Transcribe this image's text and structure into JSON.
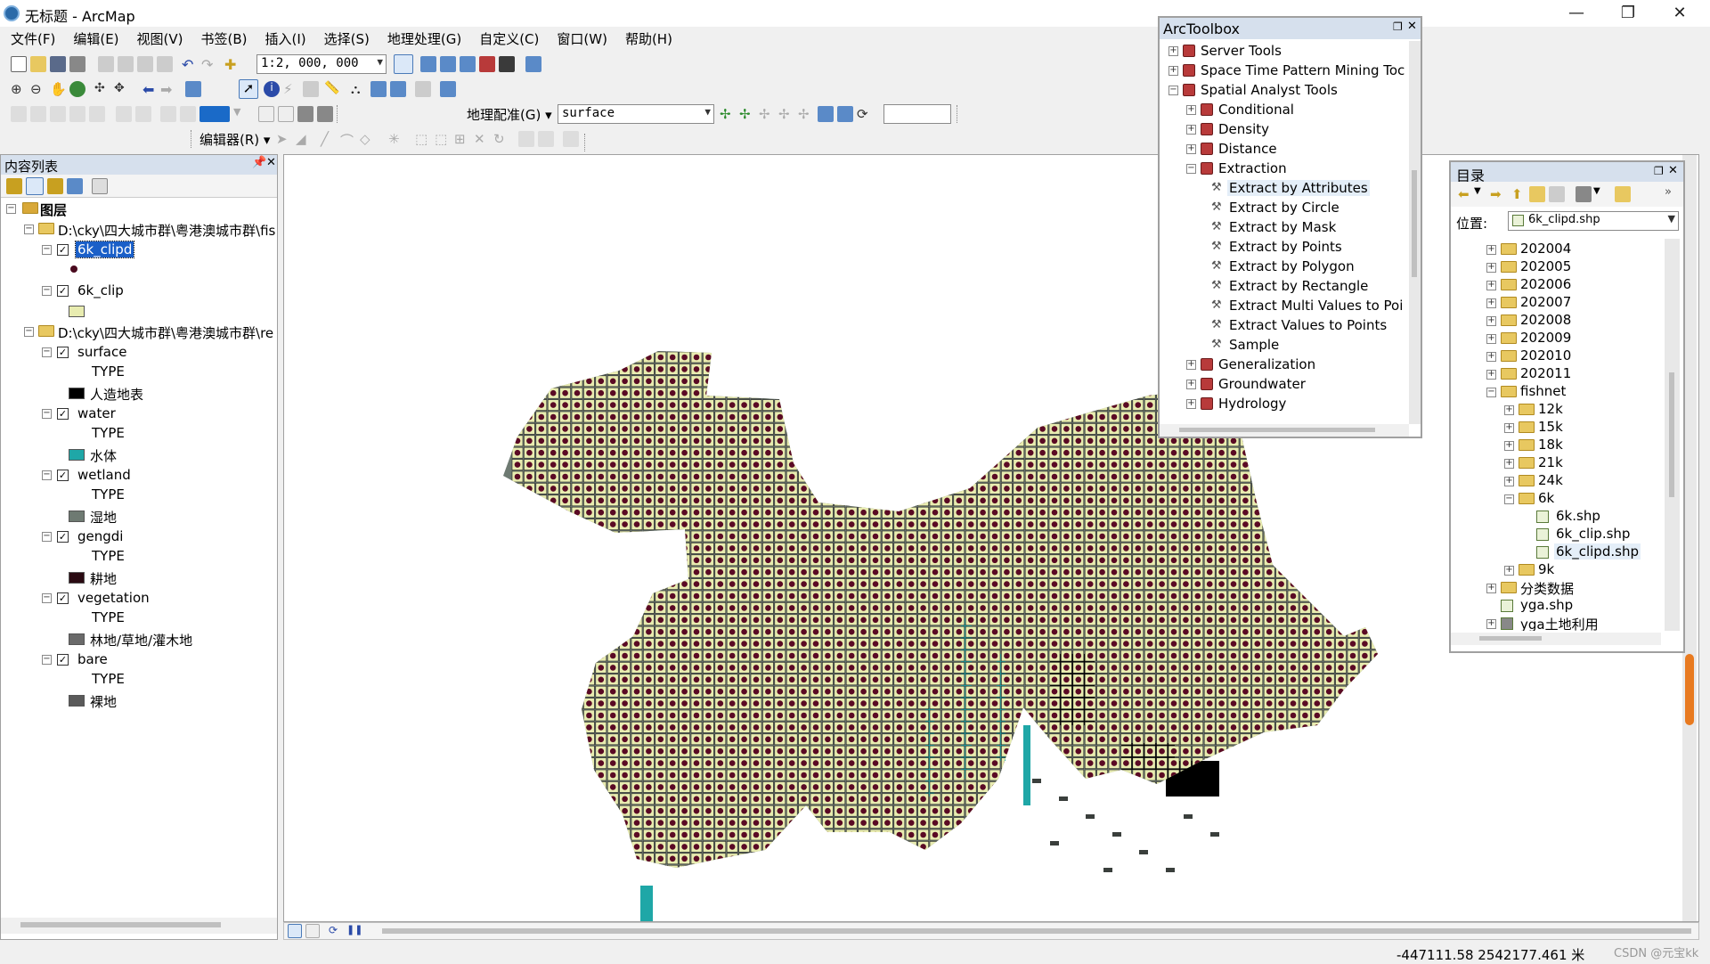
{
  "window": {
    "title": "无标题 - ArcMap",
    "minimize": "—",
    "maximize": "❐",
    "close": "✕"
  },
  "menu": [
    "文件(F)",
    "编辑(E)",
    "视图(V)",
    "书签(B)",
    "插入(I)",
    "选择(S)",
    "地理处理(G)",
    "自定义(C)",
    "窗口(W)",
    "帮助(H)"
  ],
  "toolbar": {
    "scale": "1:2, 000, 000",
    "georef_label": "地理配准(G)",
    "georef_layer": "surface",
    "editor_label": "编辑器(R)"
  },
  "toc": {
    "title": "内容列表",
    "root": "图层",
    "groups": [
      {
        "path": "D:\\cky\\四大城市群\\粤港澳城市群\\fis",
        "layers": [
          {
            "name": "6k_clipd",
            "selected": true,
            "legend": [
              {
                "label": "",
                "color": "#4a0a1e",
                "kind": "dot"
              }
            ]
          },
          {
            "name": "6k_clip",
            "selected": false,
            "legend": [
              {
                "label": "",
                "color": "#e8ecb0",
                "kind": "box"
              }
            ]
          }
        ]
      },
      {
        "path": "D:\\cky\\四大城市群\\粤港澳城市群\\re",
        "layers": [
          {
            "name": "surface",
            "field": "TYPE",
            "legend": [
              {
                "label": "人造地表",
                "color": "#000000",
                "kind": "box"
              }
            ]
          },
          {
            "name": "water",
            "field": "TYPE",
            "legend": [
              {
                "label": "水体",
                "color": "#1fa7a7",
                "kind": "box"
              }
            ]
          },
          {
            "name": "wetland",
            "field": "TYPE",
            "legend": [
              {
                "label": "湿地",
                "color": "#6e7a72",
                "kind": "box"
              }
            ]
          },
          {
            "name": "gengdi",
            "field": "TYPE",
            "legend": [
              {
                "label": "耕地",
                "color": "#2a0a12",
                "kind": "box"
              }
            ]
          },
          {
            "name": "vegetation",
            "field": "TYPE",
            "legend": [
              {
                "label": "林地/草地/灌木地",
                "color": "#6a6a6a",
                "kind": "box"
              }
            ]
          },
          {
            "name": "bare",
            "field": "TYPE",
            "legend": [
              {
                "label": "裸地",
                "color": "#5a5a5a",
                "kind": "box"
              }
            ]
          }
        ]
      }
    ]
  },
  "toolbox": {
    "title": "ArcToolbox",
    "items": [
      {
        "label": "Server Tools",
        "level": 0,
        "expanded": false,
        "kind": "box"
      },
      {
        "label": "Space Time Pattern Mining Toc",
        "level": 0,
        "expanded": false,
        "kind": "box"
      },
      {
        "label": "Spatial Analyst Tools",
        "level": 0,
        "expanded": true,
        "kind": "box"
      },
      {
        "label": "Conditional",
        "level": 1,
        "expanded": false,
        "kind": "box"
      },
      {
        "label": "Density",
        "level": 1,
        "expanded": false,
        "kind": "box"
      },
      {
        "label": "Distance",
        "level": 1,
        "expanded": false,
        "kind": "box"
      },
      {
        "label": "Extraction",
        "level": 1,
        "expanded": true,
        "kind": "box"
      },
      {
        "label": "Extract by Attributes",
        "level": 2,
        "kind": "tool",
        "highlight": true
      },
      {
        "label": "Extract by Circle",
        "level": 2,
        "kind": "tool"
      },
      {
        "label": "Extract by Mask",
        "level": 2,
        "kind": "tool"
      },
      {
        "label": "Extract by Points",
        "level": 2,
        "kind": "tool"
      },
      {
        "label": "Extract by Polygon",
        "level": 2,
        "kind": "tool"
      },
      {
        "label": "Extract by Rectangle",
        "level": 2,
        "kind": "tool"
      },
      {
        "label": "Extract Multi Values to Poi",
        "level": 2,
        "kind": "tool"
      },
      {
        "label": "Extract Values to Points",
        "level": 2,
        "kind": "tool"
      },
      {
        "label": "Sample",
        "level": 2,
        "kind": "tool"
      },
      {
        "label": "Generalization",
        "level": 1,
        "expanded": false,
        "kind": "box"
      },
      {
        "label": "Groundwater",
        "level": 1,
        "expanded": false,
        "kind": "box"
      },
      {
        "label": "Hydrology",
        "level": 1,
        "expanded": false,
        "kind": "box"
      }
    ]
  },
  "catalog": {
    "title": "目录",
    "location_label": "位置:",
    "location_value": "6k_clipd.shp",
    "items": [
      {
        "label": "202004",
        "level": 0,
        "kind": "folder",
        "expanded": false
      },
      {
        "label": "202005",
        "level": 0,
        "kind": "folder",
        "expanded": false
      },
      {
        "label": "202006",
        "level": 0,
        "kind": "folder",
        "expanded": false
      },
      {
        "label": "202007",
        "level": 0,
        "kind": "folder",
        "expanded": false
      },
      {
        "label": "202008",
        "level": 0,
        "kind": "folder",
        "expanded": false
      },
      {
        "label": "202009",
        "level": 0,
        "kind": "folder",
        "expanded": false
      },
      {
        "label": "202010",
        "level": 0,
        "kind": "folder",
        "expanded": false
      },
      {
        "label": "202011",
        "level": 0,
        "kind": "folder",
        "expanded": false
      },
      {
        "label": "fishnet",
        "level": 0,
        "kind": "folder",
        "expanded": true
      },
      {
        "label": "12k",
        "level": 1,
        "kind": "folder",
        "expanded": false
      },
      {
        "label": "15k",
        "level": 1,
        "kind": "folder",
        "expanded": false
      },
      {
        "label": "18k",
        "level": 1,
        "kind": "folder",
        "expanded": false
      },
      {
        "label": "21k",
        "level": 1,
        "kind": "folder",
        "expanded": false
      },
      {
        "label": "24k",
        "level": 1,
        "kind": "folder",
        "expanded": false
      },
      {
        "label": "6k",
        "level": 1,
        "kind": "folder",
        "expanded": true
      },
      {
        "label": "6k.shp",
        "level": 2,
        "kind": "shp"
      },
      {
        "label": "6k_clip.shp",
        "level": 2,
        "kind": "shp"
      },
      {
        "label": "6k_clipd.shp",
        "level": 2,
        "kind": "shp",
        "highlight": true
      },
      {
        "label": "9k",
        "level": 1,
        "kind": "folder",
        "expanded": false
      },
      {
        "label": "分类数据",
        "level": 0,
        "kind": "folder",
        "expanded": false
      },
      {
        "label": "yga.shp",
        "level": 0,
        "kind": "shp"
      },
      {
        "label": "yga土地利用",
        "level": 0,
        "kind": "raster",
        "expanded": false
      }
    ]
  },
  "status": {
    "coords": "-447111.58  2542177.461 米",
    "watermark": "CSDN @元宝kk"
  },
  "colors": {
    "land": "#6e7a72",
    "cell": "#e8ecb0",
    "dot": "#5a0a24",
    "water": "#1fa7a7",
    "urban": "#000000"
  }
}
